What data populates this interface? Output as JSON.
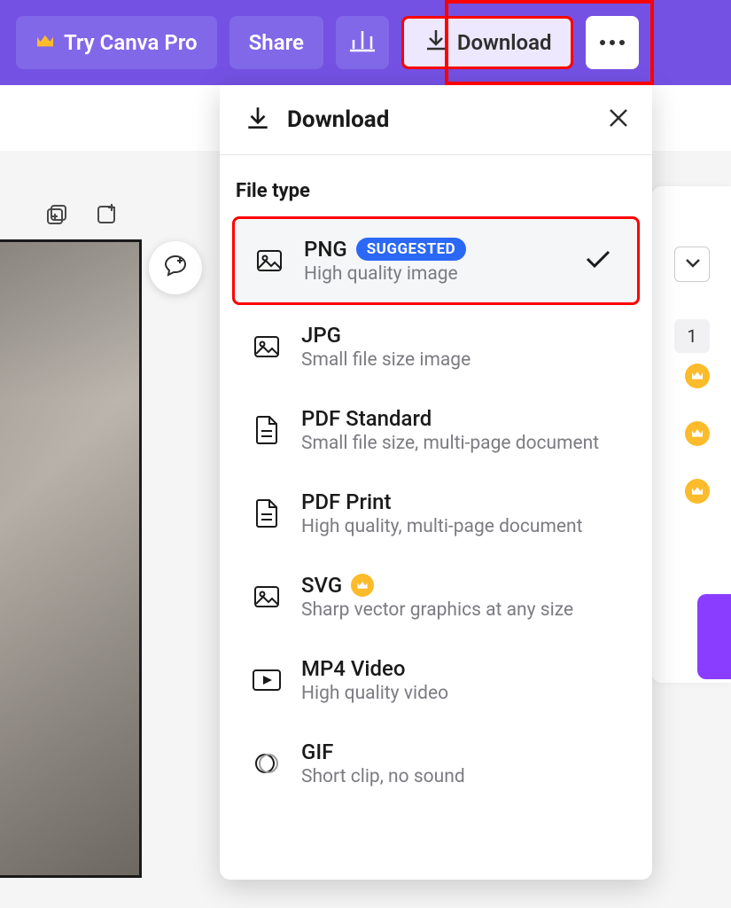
{
  "toolbar": {
    "pro_label": "Try Canva Pro",
    "share_label": "Share",
    "download_label": "Download"
  },
  "side": {
    "value_1": "1"
  },
  "panel": {
    "title": "Download",
    "file_type_label": "File type",
    "suggested_badge": "SUGGESTED",
    "types": [
      {
        "name": "PNG",
        "desc": "High quality image",
        "selected": true,
        "suggested": true,
        "icon": "image",
        "pro": false
      },
      {
        "name": "JPG",
        "desc": "Small file size image",
        "selected": false,
        "suggested": false,
        "icon": "image",
        "pro": false
      },
      {
        "name": "PDF Standard",
        "desc": "Small file size, multi-page document",
        "selected": false,
        "suggested": false,
        "icon": "doc",
        "pro": false
      },
      {
        "name": "PDF Print",
        "desc": "High quality, multi-page document",
        "selected": false,
        "suggested": false,
        "icon": "doc",
        "pro": false
      },
      {
        "name": "SVG",
        "desc": "Sharp vector graphics at any size",
        "selected": false,
        "suggested": false,
        "icon": "image",
        "pro": true
      },
      {
        "name": "MP4 Video",
        "desc": "High quality video",
        "selected": false,
        "suggested": false,
        "icon": "video",
        "pro": false
      },
      {
        "name": "GIF",
        "desc": "Short clip, no sound",
        "selected": false,
        "suggested": false,
        "icon": "gif",
        "pro": false
      }
    ]
  }
}
